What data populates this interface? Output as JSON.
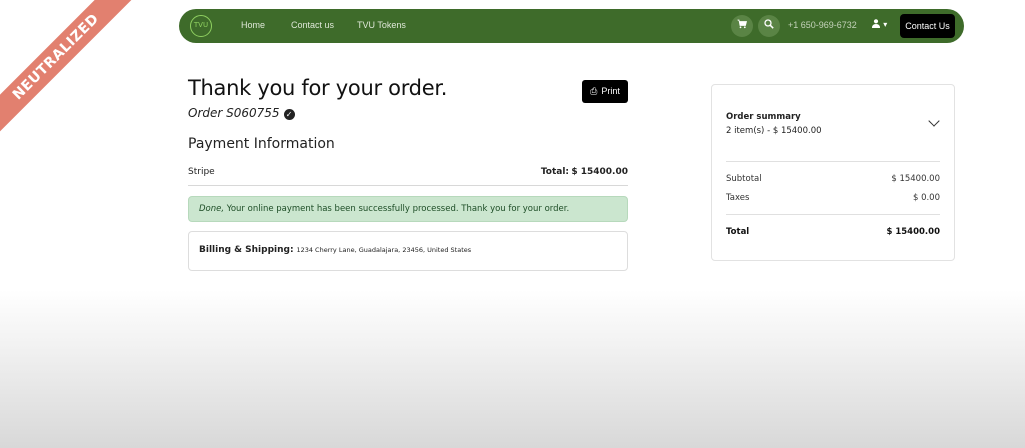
{
  "ribbon": {
    "text": "NEUTRALIZED"
  },
  "navbar": {
    "logo_text": "TVU",
    "links": [
      "Home",
      "Contact us",
      "TVU Tokens"
    ],
    "phone": "+1 650-969-6732",
    "user_caret": "▾",
    "contact_button": "Contact Us",
    "accent_color": "#3e6b2a"
  },
  "order": {
    "title": "Thank you for your order.",
    "order_label": "Order S060755",
    "print_label": "Print",
    "payment_title": "Payment Information",
    "payment_method": "Stripe",
    "total_label": "Total:",
    "total_value": "$ 15400.00",
    "alert_prefix": "Done,",
    "alert_text": " Your online payment has been successfully processed. Thank you for your order.",
    "billing_label": "Billing & Shipping:",
    "billing_address": "1234 Cherry Lane, Guadalajara, 23456, United States"
  },
  "summary": {
    "title": "Order summary",
    "items_line": "2 item(s) -  $ 15400.00",
    "subtotal_label": "Subtotal",
    "subtotal_value": "$ 15400.00",
    "taxes_label": "Taxes",
    "taxes_value": "$ 0.00",
    "total_label": "Total",
    "total_value": "$ 15400.00"
  }
}
